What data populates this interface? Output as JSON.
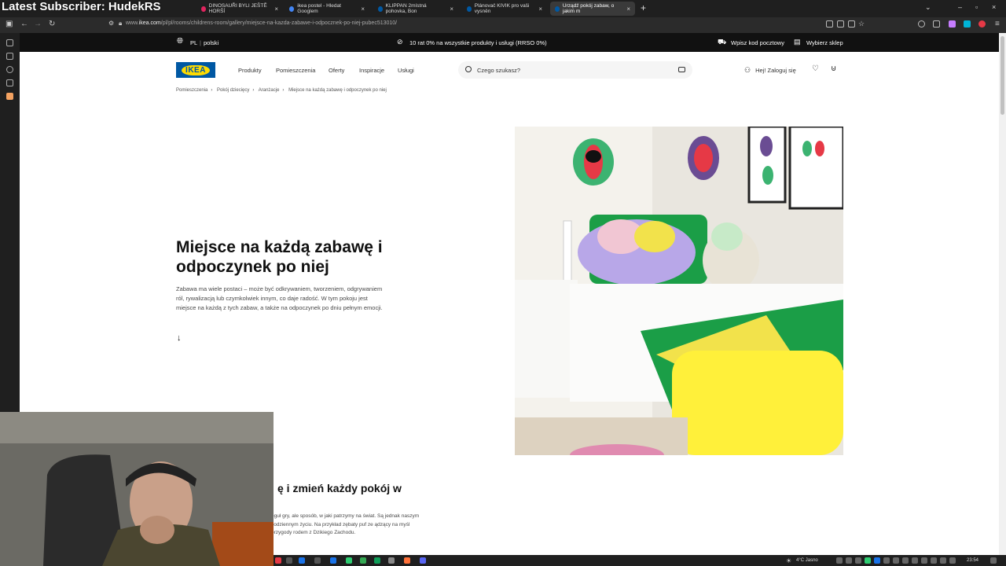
{
  "overlay": {
    "banner": "Latest Subscriber: HudekRS"
  },
  "browser": {
    "tabs": [
      {
        "label": "DINOSAUŘI BYLI JEŠTĚ HORŠÍ",
        "favicon_color": "#e0245e"
      },
      {
        "label": "ikea postel - Hledat Googlem",
        "favicon_color": "#4285f4"
      },
      {
        "label": "KLIPPAN 2místná pohovka, Bon",
        "favicon_color": "#0058a3"
      },
      {
        "label": "Plánovač KIVIK pro vaši vysněn",
        "favicon_color": "#0058a3"
      },
      {
        "label": "Urządź pokój zabaw, o jakim m",
        "favicon_color": "#0058a3"
      }
    ],
    "url_prefix": "www.",
    "url_domain": "ikea.com",
    "url_path": "/pl/pl/rooms/childrens-room/gallery/miejsce-na-kazda-zabawe-i-odpocznek-po-niej-pubec513010/"
  },
  "topstrip": {
    "country_code": "PL",
    "language": "polski",
    "promo": "10 rat 0% na wszystkie produkty i usługi (RRSO 0%)",
    "postcode": "Wpisz kod pocztowy",
    "store": "Wybierz sklep"
  },
  "header": {
    "logo_text": "IKEA",
    "nav": [
      "Produkty",
      "Pomieszczenia",
      "Oferty",
      "Inspiracje",
      "Usługi"
    ],
    "search_placeholder": "Czego szukasz?",
    "login": "Hej! Zaloguj się"
  },
  "breadcrumb": [
    "Pomieszczenia",
    "Pokój dziecięcy",
    "Aranżacje",
    "Miejsce na każdą zabawę i odpoczynek po niej"
  ],
  "main": {
    "title": "Miejsce na każdą zabawę i odpoczynek po niej",
    "intro": "Zabawa ma wiele postaci – może być odkrywaniem, tworzeniem, odgrywaniem ról, rywalizacją lub czymkolwiek innym, co daje radość. W tym pokoju jest miejsce na każdą z tych zabaw, a także na odpoczynek po dniu pełnym emocji.",
    "section2_title": "ę i zmień każdy pokój w",
    "section2_text": "eguł gry, ale sposób, w jaki patrzymy na świat. Są jednak naszym codziennym życiu. Na przykład zębaty puf ze ądzący na myśl przygody rodem z Dzikiego Zachodu."
  },
  "taskbar": {
    "weather": "4°C Jasno",
    "time": "23:54"
  },
  "colors": {
    "ikea_blue": "#0058a3",
    "ikea_yellow": "#ffdb00"
  }
}
